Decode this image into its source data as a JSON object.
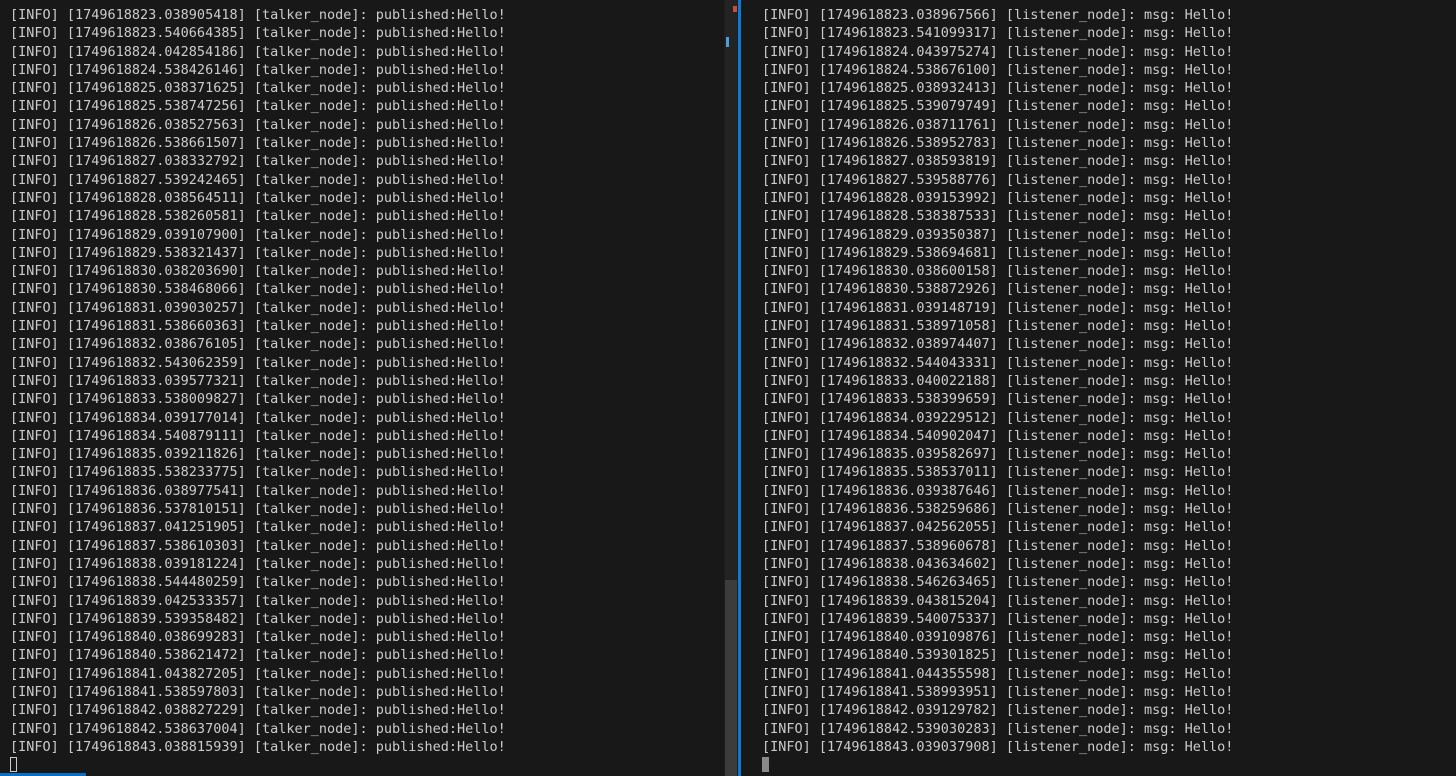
{
  "left_pane": {
    "lines": [
      "[INFO] [1749618823.038905418] [talker_node]: published:Hello!",
      "[INFO] [1749618823.540664385] [talker_node]: published:Hello!",
      "[INFO] [1749618824.042854186] [talker_node]: published:Hello!",
      "[INFO] [1749618824.538426146] [talker_node]: published:Hello!",
      "[INFO] [1749618825.038371625] [talker_node]: published:Hello!",
      "[INFO] [1749618825.538747256] [talker_node]: published:Hello!",
      "[INFO] [1749618826.038527563] [talker_node]: published:Hello!",
      "[INFO] [1749618826.538661507] [talker_node]: published:Hello!",
      "[INFO] [1749618827.038332792] [talker_node]: published:Hello!",
      "[INFO] [1749618827.539242465] [talker_node]: published:Hello!",
      "[INFO] [1749618828.038564511] [talker_node]: published:Hello!",
      "[INFO] [1749618828.538260581] [talker_node]: published:Hello!",
      "[INFO] [1749618829.039107900] [talker_node]: published:Hello!",
      "[INFO] [1749618829.538321437] [talker_node]: published:Hello!",
      "[INFO] [1749618830.038203690] [talker_node]: published:Hello!",
      "[INFO] [1749618830.538468066] [talker_node]: published:Hello!",
      "[INFO] [1749618831.039030257] [talker_node]: published:Hello!",
      "[INFO] [1749618831.538660363] [talker_node]: published:Hello!",
      "[INFO] [1749618832.038676105] [talker_node]: published:Hello!",
      "[INFO] [1749618832.543062359] [talker_node]: published:Hello!",
      "[INFO] [1749618833.039577321] [talker_node]: published:Hello!",
      "[INFO] [1749618833.538009827] [talker_node]: published:Hello!",
      "[INFO] [1749618834.039177014] [talker_node]: published:Hello!",
      "[INFO] [1749618834.540879111] [talker_node]: published:Hello!",
      "[INFO] [1749618835.039211826] [talker_node]: published:Hello!",
      "[INFO] [1749618835.538233775] [talker_node]: published:Hello!",
      "[INFO] [1749618836.038977541] [talker_node]: published:Hello!",
      "[INFO] [1749618836.537810151] [talker_node]: published:Hello!",
      "[INFO] [1749618837.041251905] [talker_node]: published:Hello!",
      "[INFO] [1749618837.538610303] [talker_node]: published:Hello!",
      "[INFO] [1749618838.039181224] [talker_node]: published:Hello!",
      "[INFO] [1749618838.544480259] [talker_node]: published:Hello!",
      "[INFO] [1749618839.042533357] [talker_node]: published:Hello!",
      "[INFO] [1749618839.539358482] [talker_node]: published:Hello!",
      "[INFO] [1749618840.038699283] [talker_node]: published:Hello!",
      "[INFO] [1749618840.538621472] [talker_node]: published:Hello!",
      "[INFO] [1749618841.043827205] [talker_node]: published:Hello!",
      "[INFO] [1749618841.538597803] [talker_node]: published:Hello!",
      "[INFO] [1749618842.038827229] [talker_node]: published:Hello!",
      "[INFO] [1749618842.538637004] [talker_node]: published:Hello!",
      "[INFO] [1749618843.038815939] [talker_node]: published:Hello!"
    ]
  },
  "right_pane": {
    "lines": [
      "[INFO] [1749618823.038967566] [listener_node]: msg: Hello!",
      "[INFO] [1749618823.541099317] [listener_node]: msg: Hello!",
      "[INFO] [1749618824.043975274] [listener_node]: msg: Hello!",
      "[INFO] [1749618824.538676100] [listener_node]: msg: Hello!",
      "[INFO] [1749618825.038932413] [listener_node]: msg: Hello!",
      "[INFO] [1749618825.539079749] [listener_node]: msg: Hello!",
      "[INFO] [1749618826.038711761] [listener_node]: msg: Hello!",
      "[INFO] [1749618826.538952783] [listener_node]: msg: Hello!",
      "[INFO] [1749618827.038593819] [listener_node]: msg: Hello!",
      "[INFO] [1749618827.539588776] [listener_node]: msg: Hello!",
      "[INFO] [1749618828.039153992] [listener_node]: msg: Hello!",
      "[INFO] [1749618828.538387533] [listener_node]: msg: Hello!",
      "[INFO] [1749618829.039350387] [listener_node]: msg: Hello!",
      "[INFO] [1749618829.538694681] [listener_node]: msg: Hello!",
      "[INFO] [1749618830.038600158] [listener_node]: msg: Hello!",
      "[INFO] [1749618830.538872926] [listener_node]: msg: Hello!",
      "[INFO] [1749618831.039148719] [listener_node]: msg: Hello!",
      "[INFO] [1749618831.538971058] [listener_node]: msg: Hello!",
      "[INFO] [1749618832.038974407] [listener_node]: msg: Hello!",
      "[INFO] [1749618832.544043331] [listener_node]: msg: Hello!",
      "[INFO] [1749618833.040022188] [listener_node]: msg: Hello!",
      "[INFO] [1749618833.538399659] [listener_node]: msg: Hello!",
      "[INFO] [1749618834.039229512] [listener_node]: msg: Hello!",
      "[INFO] [1749618834.540902047] [listener_node]: msg: Hello!",
      "[INFO] [1749618835.039582697] [listener_node]: msg: Hello!",
      "[INFO] [1749618835.538537011] [listener_node]: msg: Hello!",
      "[INFO] [1749618836.039387646] [listener_node]: msg: Hello!",
      "[INFO] [1749618836.538259686] [listener_node]: msg: Hello!",
      "[INFO] [1749618837.042562055] [listener_node]: msg: Hello!",
      "[INFO] [1749618837.538960678] [listener_node]: msg: Hello!",
      "[INFO] [1749618838.043634602] [listener_node]: msg: Hello!",
      "[INFO] [1749618838.546263465] [listener_node]: msg: Hello!",
      "[INFO] [1749618839.043815204] [listener_node]: msg: Hello!",
      "[INFO] [1749618839.540075337] [listener_node]: msg: Hello!",
      "[INFO] [1749618840.039109876] [listener_node]: msg: Hello!",
      "[INFO] [1749618840.539301825] [listener_node]: msg: Hello!",
      "[INFO] [1749618841.044355598] [listener_node]: msg: Hello!",
      "[INFO] [1749618841.538993951] [listener_node]: msg: Hello!",
      "[INFO] [1749618842.039129782] [listener_node]: msg: Hello!",
      "[INFO] [1749618842.539030283] [listener_node]: msg: Hello!",
      "[INFO] [1749618843.039037908] [listener_node]: msg: Hello!"
    ]
  },
  "colors": {
    "background": "#181818",
    "text": "#cccccc",
    "sash": "#0a7ad6",
    "scroll_marker_error": "#c74e39",
    "scroll_marker_info": "#4a9fd8"
  }
}
